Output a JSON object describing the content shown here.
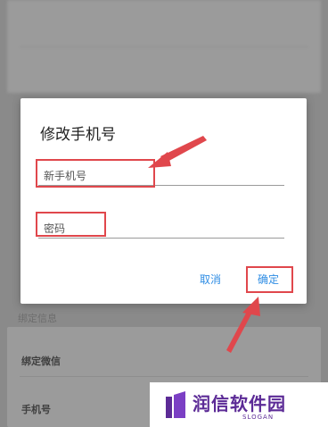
{
  "background": {
    "section_label": "绑定信息",
    "rows": [
      {
        "label": "绑定微信"
      },
      {
        "label": "手机号"
      }
    ]
  },
  "dialog": {
    "title": "修改手机号",
    "phone_field": {
      "placeholder": "新手机号"
    },
    "password_field": {
      "placeholder": "密码"
    },
    "cancel_label": "取消",
    "confirm_label": "确定"
  },
  "brand": {
    "name": "润信软件园",
    "slogan": "SLOGAN"
  },
  "colors": {
    "accent": "#2f8de4",
    "annotation": "#e0474c",
    "brand": "#5c2b96"
  }
}
